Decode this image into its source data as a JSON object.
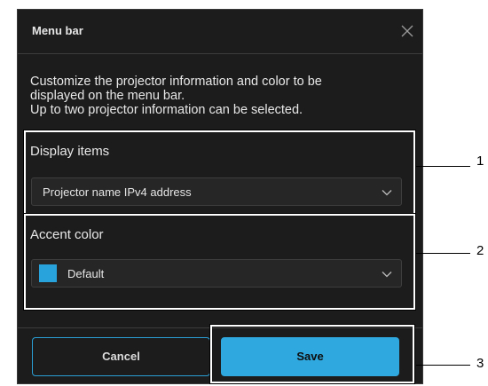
{
  "dialog": {
    "title": "Menu bar",
    "description": [
      "Customize the projector information and color to be",
      "displayed on the menu bar.",
      "Up to two projector information can be selected."
    ]
  },
  "display_items": {
    "label": "Display items",
    "selected": "Projector name IPv4 address"
  },
  "accent_color": {
    "label": "Accent color",
    "selected": "Default",
    "swatch_color": "#29a3dc"
  },
  "buttons": {
    "cancel": "Cancel",
    "save": "Save"
  },
  "callouts": [
    "1",
    "2",
    "3"
  ],
  "colors": {
    "dialog_bg": "#1c1c1c",
    "accent": "#2ea8df"
  },
  "icons": {
    "close": "close-icon",
    "dropdown": "chevron-down-icon"
  }
}
